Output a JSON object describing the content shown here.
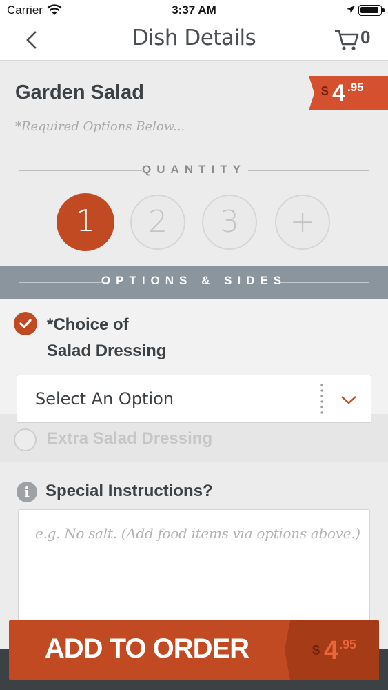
{
  "status_bar": {
    "carrier": "Carrier",
    "time": "3:37 AM"
  },
  "nav": {
    "title": "Dish Details",
    "cart_count": "0"
  },
  "dish": {
    "name": "Garden Salad",
    "required_note": "*Required Options Below...",
    "price": {
      "currency": "$",
      "whole": "4",
      "cents": ".95"
    }
  },
  "quantity": {
    "label": "QUANTITY",
    "options": [
      "1",
      "2",
      "3",
      "+"
    ],
    "selected": "1"
  },
  "options_section": {
    "label": "OPTIONS & SIDES"
  },
  "options": {
    "dressing": {
      "title_line1": "*Choice of",
      "title_line2": "Salad Dressing",
      "checked": true
    },
    "select": {
      "value": "Select An Option"
    },
    "extra": {
      "label": "Extra Salad Dressing",
      "checked": false
    }
  },
  "special": {
    "title": "Special Instructions?",
    "placeholder": "e.g. No salt. (Add food items via options above.)"
  },
  "add_button": {
    "label": "ADD TO ORDER",
    "price": {
      "currency": "$",
      "whole": "4",
      "cents": ".95"
    }
  },
  "colors": {
    "accent": "#c24a22",
    "price_tag": "#d4502e",
    "section_bar": "#8a959e",
    "text_dark": "#3c4145"
  }
}
